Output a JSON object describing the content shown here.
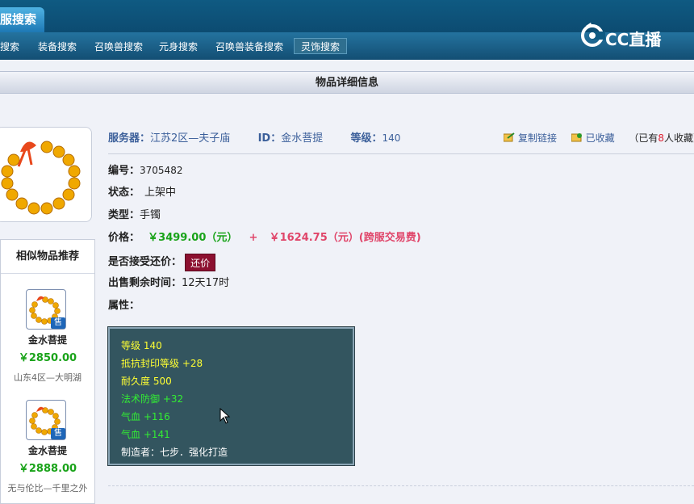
{
  "header": {
    "active_tab": "服搜索",
    "nav": [
      {
        "label": "搜索"
      },
      {
        "label": "装备搜索"
      },
      {
        "label": "召唤兽搜索"
      },
      {
        "label": "元身搜索"
      },
      {
        "label": "召唤兽装备搜索"
      },
      {
        "label": "灵饰搜索"
      }
    ],
    "logo_text": "CC直播"
  },
  "title": "物品详细信息",
  "item": {
    "server_label": "服务器：",
    "server": "江苏2区—夫子庙",
    "id_label": "ID：",
    "id": "金水菩提",
    "level_label": "等级：",
    "level": "140",
    "copy_link": "复制链接",
    "favorited": "已收藏",
    "fav_prefix": "（已有",
    "fav_count": "8",
    "fav_suffix": "人收藏）",
    "number_label": "编号：",
    "number": "3705482",
    "status_label": "状态：",
    "status": "上架中",
    "type_label": "类型：",
    "type": "手镯",
    "price_label": "价格：",
    "price": "￥3499.00（元）",
    "price_plus": "+",
    "fee": "￥1624.75（元）(跨服交易费)",
    "bargain_label": "是否接受还价：",
    "bargain_button": "还价",
    "remaining_label": "出售剩余时间：",
    "remaining": "12天17时",
    "attr_label": "属性："
  },
  "attributes": [
    {
      "text": "等级 140",
      "color": "yellow"
    },
    {
      "text": "抵抗封印等级 +28",
      "color": "yellow"
    },
    {
      "text": "耐久度 500",
      "color": "yellow"
    },
    {
      "text": "法术防御 +32",
      "color": "green"
    },
    {
      "text": "气血 +116",
      "color": "green"
    },
    {
      "text": "气血 +141",
      "color": "green"
    },
    {
      "text": "制造者：七步．强化打造",
      "color": "white"
    }
  ],
  "similar": {
    "title": "相似物品推荐",
    "sale_badge": "售",
    "items": [
      {
        "name": "金水菩提",
        "price": "￥2850.00",
        "seller": "山东4区—大明湖"
      },
      {
        "name": "金水菩提",
        "price": "￥2888.00",
        "seller": "无与伦比—千里之外"
      }
    ]
  },
  "colors": {
    "price_green": "#19a319",
    "fee_pink": "#e0466a",
    "attr_bg": "#33555f",
    "header_blue": "#0a3f63"
  }
}
